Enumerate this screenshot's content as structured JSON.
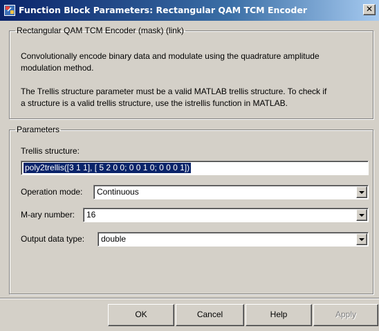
{
  "window": {
    "title": "Function Block Parameters: Rectangular QAM TCM Encoder",
    "close_glyph": "✕",
    "icon": "simulink-block-icon"
  },
  "mask_group": {
    "legend": "Rectangular QAM TCM Encoder (mask) (link)",
    "description_lines": [
      "Convolutionally encode binary data and modulate using the quadrature amplitude",
      "modulation method.",
      "The Trellis structure parameter must be a valid MATLAB trellis structure. To check if",
      "a structure is a valid trellis structure, use the istrellis function in MATLAB."
    ]
  },
  "params_group": {
    "legend": "Parameters",
    "trellis_label": "Trellis structure:",
    "trellis_value": "poly2trellis([3 1 1], [ 5 2 0 0; 0 0 1 0; 0 0 0 1])",
    "operation_label": "Operation mode:",
    "operation_value": "Continuous",
    "mary_label": "M-ary number:",
    "mary_value": "16",
    "output_label": "Output data type:",
    "output_value": "double"
  },
  "buttons": {
    "ok": "OK",
    "cancel": "Cancel",
    "help": "Help",
    "apply": "Apply"
  },
  "colors": {
    "title_bar": "#0a246a",
    "dialog_bg": "#d4d0c8",
    "selection": "#0a246a"
  }
}
